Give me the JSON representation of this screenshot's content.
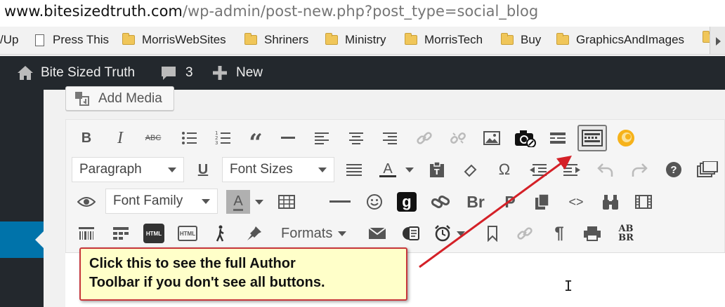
{
  "browser": {
    "url_host": "www.bitesizedtruth.com",
    "url_path": "/wp-admin/post-new.php?post_type=social_blog"
  },
  "bookmarks": [
    {
      "label": "/Up",
      "icon": "none"
    },
    {
      "label": "Press This",
      "icon": "page-icon"
    },
    {
      "label": "MorrisWebSites",
      "icon": "folder-icon"
    },
    {
      "label": "Shriners",
      "icon": "folder-icon"
    },
    {
      "label": "Ministry",
      "icon": "folder-icon"
    },
    {
      "label": "MorrisTech",
      "icon": "folder-icon"
    },
    {
      "label": "Buy",
      "icon": "folder-icon"
    },
    {
      "label": "GraphicsAndImages",
      "icon": "folder-icon"
    }
  ],
  "adminbar": {
    "site_name": "Bite Sized Truth",
    "comments_count": "3",
    "new_label": "New"
  },
  "editor": {
    "add_media_label": "Add Media",
    "paragraph_select": "Paragraph",
    "font_sizes_select": "Font Sizes",
    "font_family_select": "Font Family",
    "formats_label": "Formats",
    "bold_label": "B",
    "italic_label": "I",
    "strike_label": "ABC",
    "quote_label": "“",
    "underline_label": "U",
    "text_color_label": "A",
    "omega_label": "Ω",
    "bg_color_label": "A",
    "br_label": "Br",
    "p_label": "P",
    "code_label": "<>",
    "html_label": "HTML",
    "html2_label": "HTML",
    "pilcrow_label": "¶",
    "abbr_line1": "AB",
    "abbr_line2": "BR",
    "google_label": "g",
    "help_label": "?"
  },
  "callout": {
    "line1": "Click this to see the full Author",
    "line2": "Toolbar if you don't see all buttons."
  },
  "colors": {
    "adminbar_bg": "#23282d",
    "active_menu": "#0073aa",
    "callout_bg": "#ffffc9",
    "callout_border": "#c7363b",
    "arrow": "#d42027"
  }
}
